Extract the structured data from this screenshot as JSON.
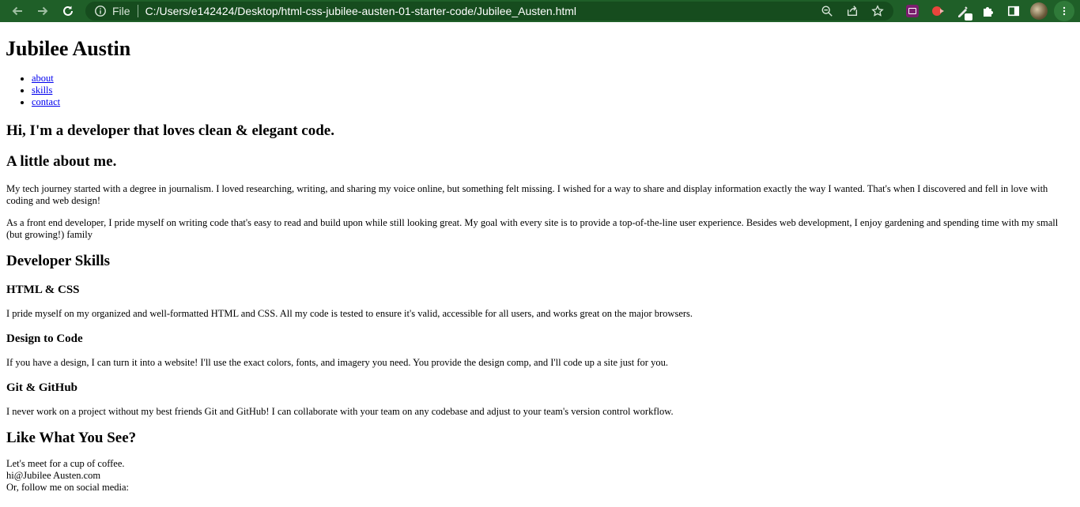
{
  "browser": {
    "file_label": "File",
    "url": "C:/Users/e142424/Desktop/html-css-jubilee-austen-01-starter-code/Jubilee_Austen.html",
    "icons": [
      "back-icon",
      "forward-icon",
      "reload-icon",
      "info-icon",
      "zoom-icon",
      "share-icon",
      "star-icon",
      "extension-icon",
      "puzzle-icon",
      "sidepanel-icon",
      "avatar",
      "menu-icon"
    ]
  },
  "page": {
    "title": "Jubilee Austin",
    "nav": [
      "about",
      "skills",
      "contact"
    ],
    "intro": "Hi, I'm a developer that loves clean & elegant code.",
    "about": {
      "heading": "A little about me.",
      "p1": "My tech journey started with a degree in journalism. I loved researching, writing, and sharing my voice online, but something felt missing. I wished for a way to share and display information exactly the way I wanted. That's when I discovered and fell in love with coding and web design!",
      "p2": "As a front end developer, I pride myself on writing code that's easy to read and build upon while still looking great. My goal with every site is to provide a top-of-the-line user experience. Besides web development, I enjoy gardening and spending time with my small (but growing!) family"
    },
    "skills": {
      "heading": "Developer Skills",
      "items": [
        {
          "title": "HTML & CSS",
          "text": "I pride myself on my organized and well-formatted HTML and CSS. All my code is tested to ensure it's valid, accessible for all users, and works great on the major browsers."
        },
        {
          "title": "Design to Code",
          "text": "If you have a design, I can turn it into a website! I'll use the exact colors, fonts, and imagery you need. You provide the design comp, and I'll code up a site just for you."
        },
        {
          "title": "Git & GitHub",
          "text": "I never work on a project without my best friends Git and GitHub! I can collaborate with your team on any codebase and adjust to your team's version control workflow."
        }
      ]
    },
    "contact": {
      "heading": "Like What You See?",
      "line1": "Let's meet for a cup of coffee.",
      "email": "hi@Jubilee Austen.com",
      "line3": "Or, follow me on social media:"
    }
  }
}
